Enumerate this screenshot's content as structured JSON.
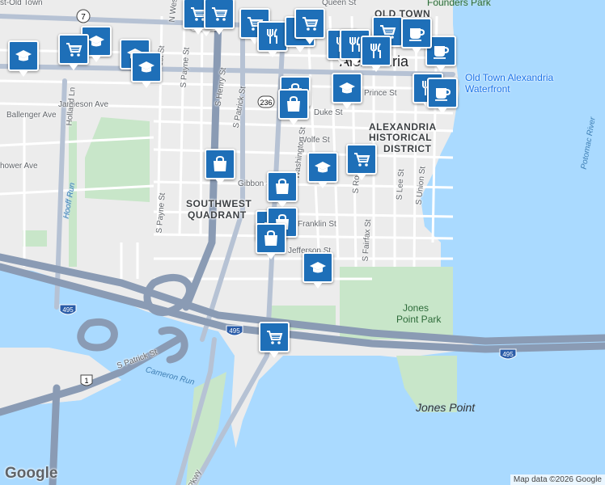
{
  "map": {
    "district_labels": [
      "SOUTHWEST",
      "QUADRANT",
      "ALEXANDRIA",
      "HISTORICAL",
      "DISTRICT",
      "OLD TOWN"
    ],
    "city_label": "Alexandria",
    "neighborhood_label": "st-Old Town",
    "street_labels": [
      "Queen St",
      "S West St",
      "S Payne St",
      "N West St",
      "S Henry St",
      "S Patrick St",
      "Jamieson Ave",
      "Ballenger Ave",
      "Holland Ln",
      "hower Ave",
      "Gibbon St",
      "Duke St",
      "Wolfe St",
      "Franklin St",
      "Jefferson St",
      "S Payne St",
      "S Fairfax St",
      "S Lee St",
      "S Union St",
      "S Ro",
      "Washington St",
      "Prince St",
      "Pkwy"
    ],
    "water_labels": [
      "Potomac River",
      "Hooff Run",
      "Cameron Run"
    ],
    "park_labels": [
      "Jones",
      "Point Park",
      "Founders Park"
    ],
    "place_labels": [
      "Jones Point"
    ],
    "poi_label": "Old Town Alexandria Waterfront",
    "route_shields": [
      "7",
      "236",
      "495",
      "495",
      "495",
      "1"
    ],
    "attribution": "Map data ©2026 Google",
    "logo": "Google"
  },
  "markers": [
    {
      "icon": "shopping-cart-icon"
    },
    {
      "icon": "school-icon"
    },
    {
      "icon": "shopping-cart-icon"
    },
    {
      "icon": "school-icon"
    },
    {
      "icon": "school-icon"
    },
    {
      "icon": "school-icon"
    },
    {
      "icon": "shopping-cart-icon"
    },
    {
      "icon": "shopping-cart-icon"
    },
    {
      "icon": "shopping-cart-icon"
    },
    {
      "icon": "restaurant-icon"
    },
    {
      "icon": "restaurant-icon"
    },
    {
      "icon": "restaurant-icon"
    },
    {
      "icon": "shopping-cart-icon"
    },
    {
      "icon": "restaurant-icon"
    },
    {
      "icon": "restaurant-icon"
    },
    {
      "icon": "shopping-cart-icon"
    },
    {
      "icon": "coffee-icon"
    },
    {
      "icon": "coffee-icon"
    },
    {
      "icon": "restaurant-icon"
    },
    {
      "icon": "coffee-icon"
    },
    {
      "icon": "shopping-bag-icon"
    },
    {
      "icon": "shopping-bag-icon"
    },
    {
      "icon": "school-icon"
    },
    {
      "icon": "shopping-cart-icon"
    },
    {
      "icon": "shopping-bag-icon"
    },
    {
      "icon": "school-icon"
    },
    {
      "icon": "shopping-bag-icon"
    },
    {
      "icon": "shopping-bag-icon"
    },
    {
      "icon": "shopping-bag-icon"
    },
    {
      "icon": "shopping-bag-icon"
    },
    {
      "icon": "school-icon"
    },
    {
      "icon": "shopping-cart-icon"
    }
  ],
  "colors": {
    "water": "#aadaff",
    "park": "#c8e6c9",
    "highway": "#8a9bb4",
    "marker": "#1e6fb8"
  }
}
